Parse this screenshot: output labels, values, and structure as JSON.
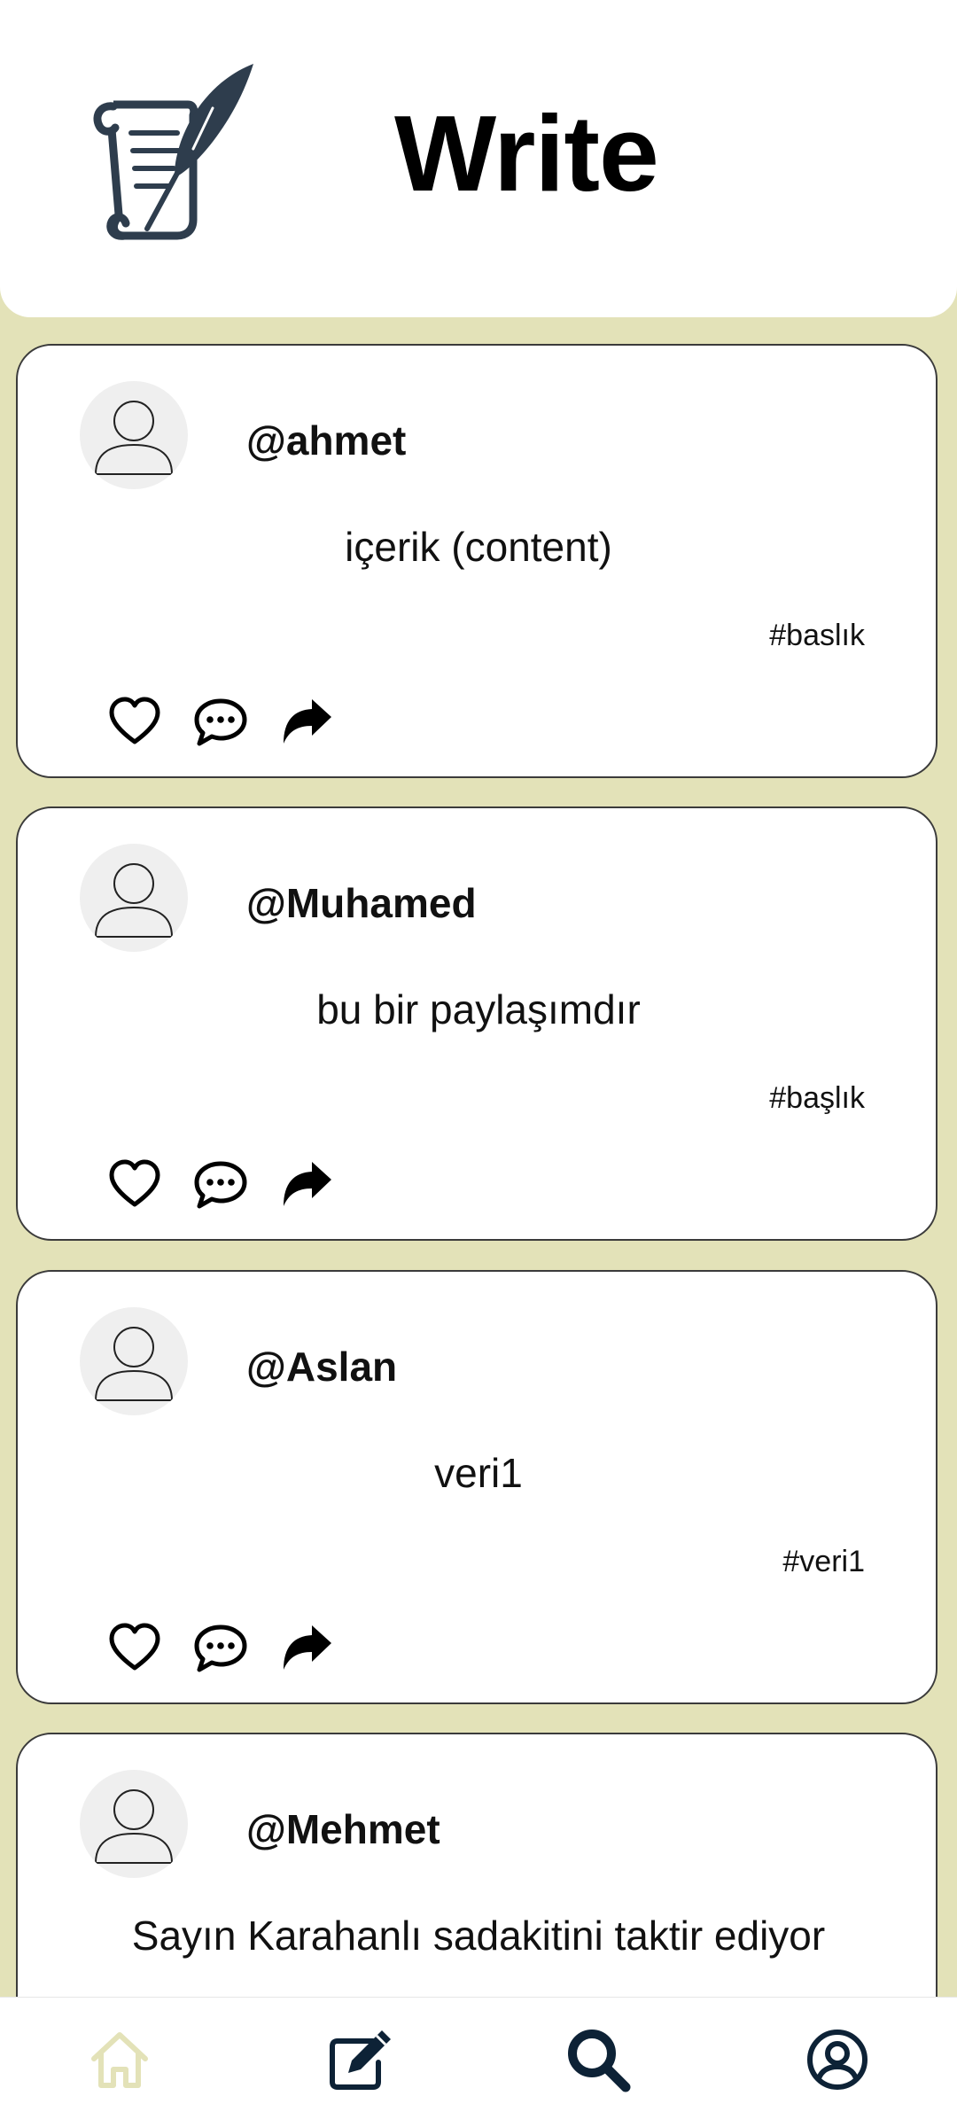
{
  "app": {
    "title": "Write",
    "accent_color": "#e3e2b8",
    "logo_icon": "scroll-quill-icon"
  },
  "posts": [
    {
      "username": "@ahmet",
      "content": "içerik (content)",
      "hashtag": "#baslık"
    },
    {
      "username": "@Muhamed",
      "content": "bu bir paylaşımdır",
      "hashtag": "#başlık"
    },
    {
      "username": "@Aslan",
      "content": "veri1",
      "hashtag": "#veri1"
    },
    {
      "username": "@Mehmet",
      "content": "Sayın Karahanlı sadakitini taktir ediyor",
      "hashtag": ""
    }
  ],
  "post_actions": [
    "heart-icon",
    "comment-icon",
    "share-icon"
  ],
  "bottom_nav": [
    {
      "name": "home",
      "icon": "home-icon",
      "active": true
    },
    {
      "name": "write",
      "icon": "edit-icon",
      "active": false
    },
    {
      "name": "search",
      "icon": "search-icon",
      "active": false
    },
    {
      "name": "profile",
      "icon": "user-circle-icon",
      "active": false
    }
  ]
}
